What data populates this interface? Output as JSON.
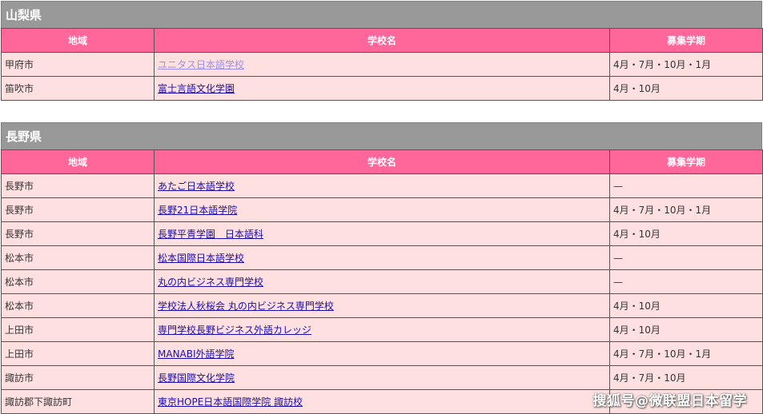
{
  "columns": {
    "area": "地域",
    "school": "学校名",
    "term": "募集学期"
  },
  "sections": [
    {
      "title": "山梨県",
      "rows": [
        {
          "area": "甲府市",
          "school": "ユニタス日本語学校",
          "term": "4月・7月・10月・1月"
        },
        {
          "area": "笛吹市",
          "school": "富士言語文化学園",
          "term": "4月・10月"
        }
      ]
    },
    {
      "title": "長野県",
      "rows": [
        {
          "area": "長野市",
          "school": "あたご日本語学校",
          "term": "—"
        },
        {
          "area": "長野市",
          "school": "長野21日本語学院",
          "term": "4月・7月・10月・1月"
        },
        {
          "area": "長野市",
          "school": "長野平青学園　日本語科",
          "term": "4月・10月"
        },
        {
          "area": "松本市",
          "school": "松本国際日本語学校",
          "term": "—"
        },
        {
          "area": "松本市",
          "school": "丸の内ビジネス専門学校",
          "term": "—"
        },
        {
          "area": "松本市",
          "school": "学校法人秋桜会 丸の内ビジネス専門学校",
          "term": "4月・10月"
        },
        {
          "area": "上田市",
          "school": "専門学校長野ビジネス外語カレッジ",
          "term": "4月・10月"
        },
        {
          "area": "上田市",
          "school": "MANABI外語学院",
          "term": "4月・7月・10月・1月"
        },
        {
          "area": "諏訪市",
          "school": "長野国際文化学院",
          "term": "4月・7月・10月"
        },
        {
          "area": "諏訪郡下諏訪町",
          "school": "東京HOPE日本語国際学院 諏訪校",
          "term": ""
        }
      ]
    }
  ],
  "watermark": "搜狐号@微联盟日本留学"
}
